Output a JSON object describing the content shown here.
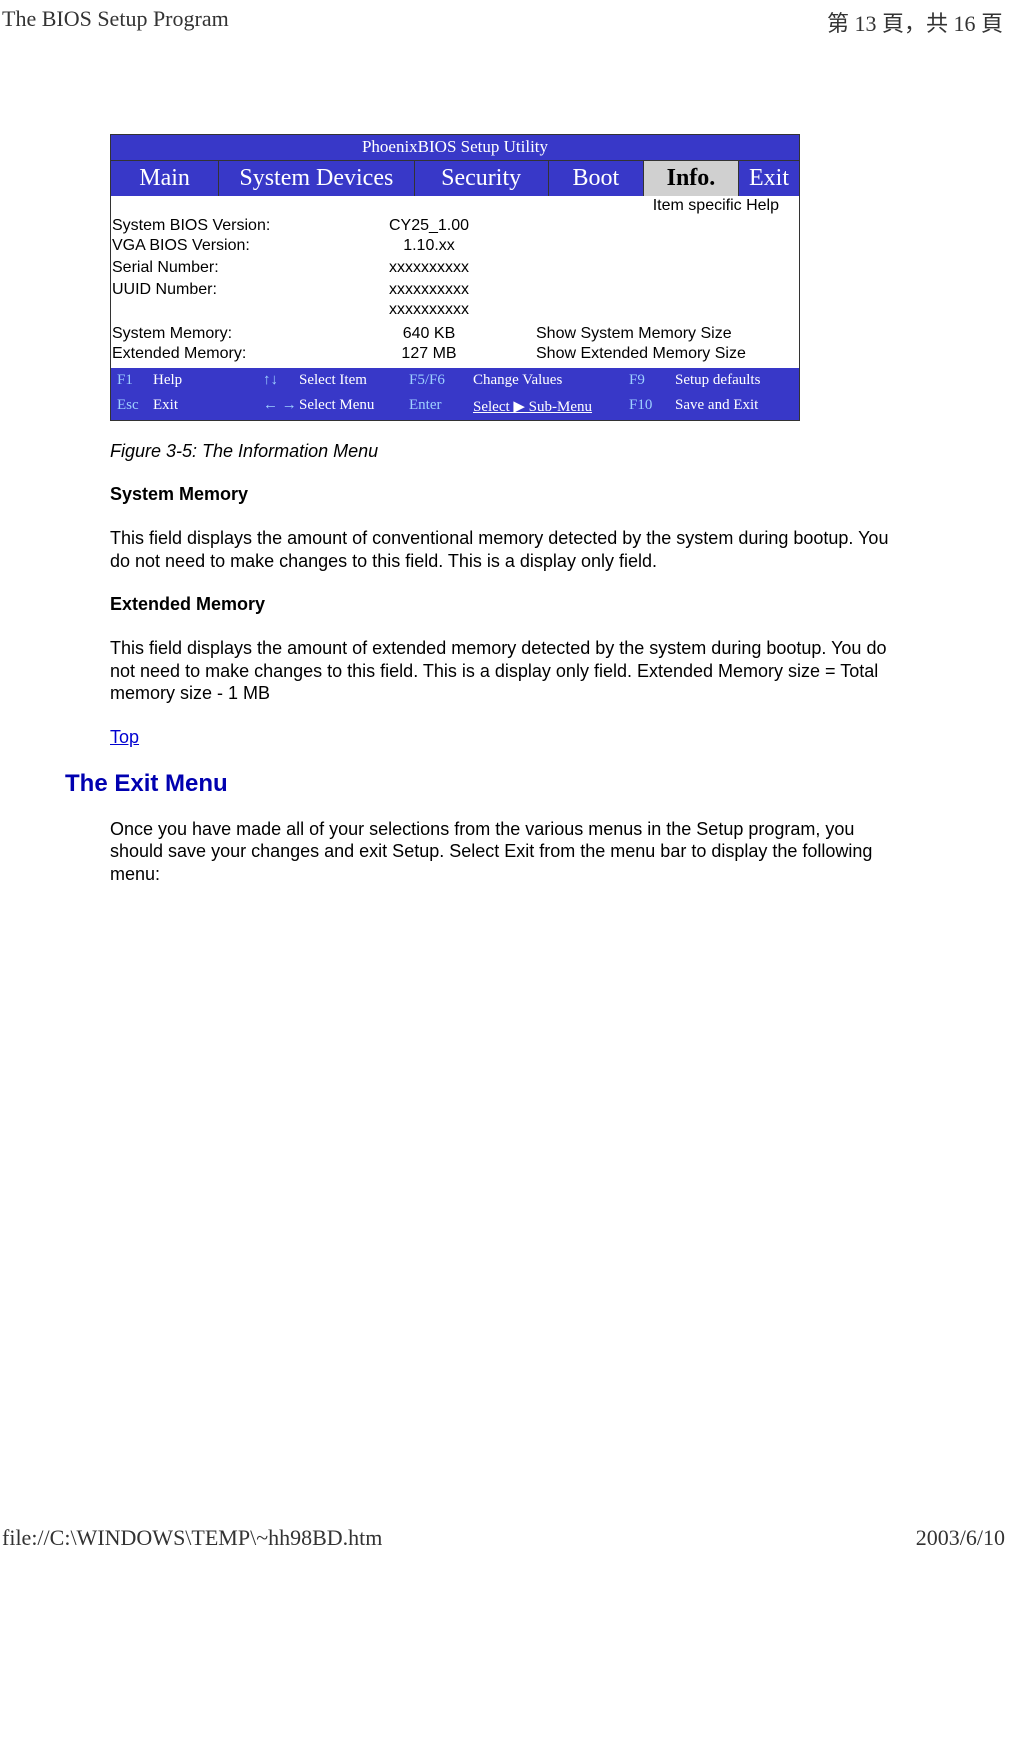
{
  "header": {
    "left": "The BIOS Setup Program",
    "right": "第 13 頁，共 16 頁"
  },
  "bios": {
    "title": "PhoenixBIOS Setup Utility",
    "menu": {
      "main": "Main",
      "system_devices": "System Devices",
      "security": "Security",
      "boot": "Boot",
      "info": "Info.",
      "exit": "Exit"
    },
    "help_header": "Item specific Help",
    "rows": {
      "sys_bios_label": "System BIOS Version:",
      "sys_bios_val": "CY25_1.00",
      "vga_bios_label": "VGA BIOS Version:",
      "vga_bios_val": "1.10.xx",
      "serial_label": "Serial Number:",
      "serial_val": "xxxxxxxxxx",
      "uuid_label": "UUID Number:",
      "uuid_val1": "xxxxxxxxxx",
      "uuid_val2": "xxxxxxxxxx",
      "sys_mem_label": "System Memory:",
      "sys_mem_val": "640 KB",
      "sys_mem_help": "Show System Memory Size",
      "ext_mem_label": "Extended Memory:",
      "ext_mem_val": "127 MB",
      "ext_mem_help": "Show Extended Memory Size"
    },
    "footer": {
      "f1": "F1",
      "f1t": "Help",
      "updown": "↑↓",
      "updownt": "Select Item",
      "f5f6": "F5/F6",
      "f5f6t": "Change Values",
      "f9": "F9",
      "f9t": "Setup defaults",
      "esc": "Esc",
      "esct": "Exit",
      "lr": "←  →",
      "lrt": "Select Menu",
      "enter": "Enter",
      "entert": "Select ▶ Sub-Menu",
      "f10": "F10",
      "f10t": "Save and Exit"
    }
  },
  "doc": {
    "caption": "Figure 3-5: The Information Menu",
    "h_sysmem": "System Memory",
    "p_sysmem": "This field displays the amount of conventional memory detected by the system during bootup. You do not need to make changes to this field. This is a display only field.",
    "h_extmem": "Extended Memory",
    "p_extmem": "This field displays the amount of extended memory detected by the system during bootup. You do not need to make changes to this field. This is a display only field. Extended Memory size = Total memory size - 1 MB",
    "toplink": "Top",
    "h_exit": "The Exit Menu",
    "p_exit": "Once you have made all of your selections from the various menus in the Setup program, you should save your changes and exit Setup. Select Exit from the menu bar to display the following menu:"
  },
  "footer": {
    "left": "file://C:\\WINDOWS\\TEMP\\~hh98BD.htm",
    "right": "2003/6/10"
  }
}
